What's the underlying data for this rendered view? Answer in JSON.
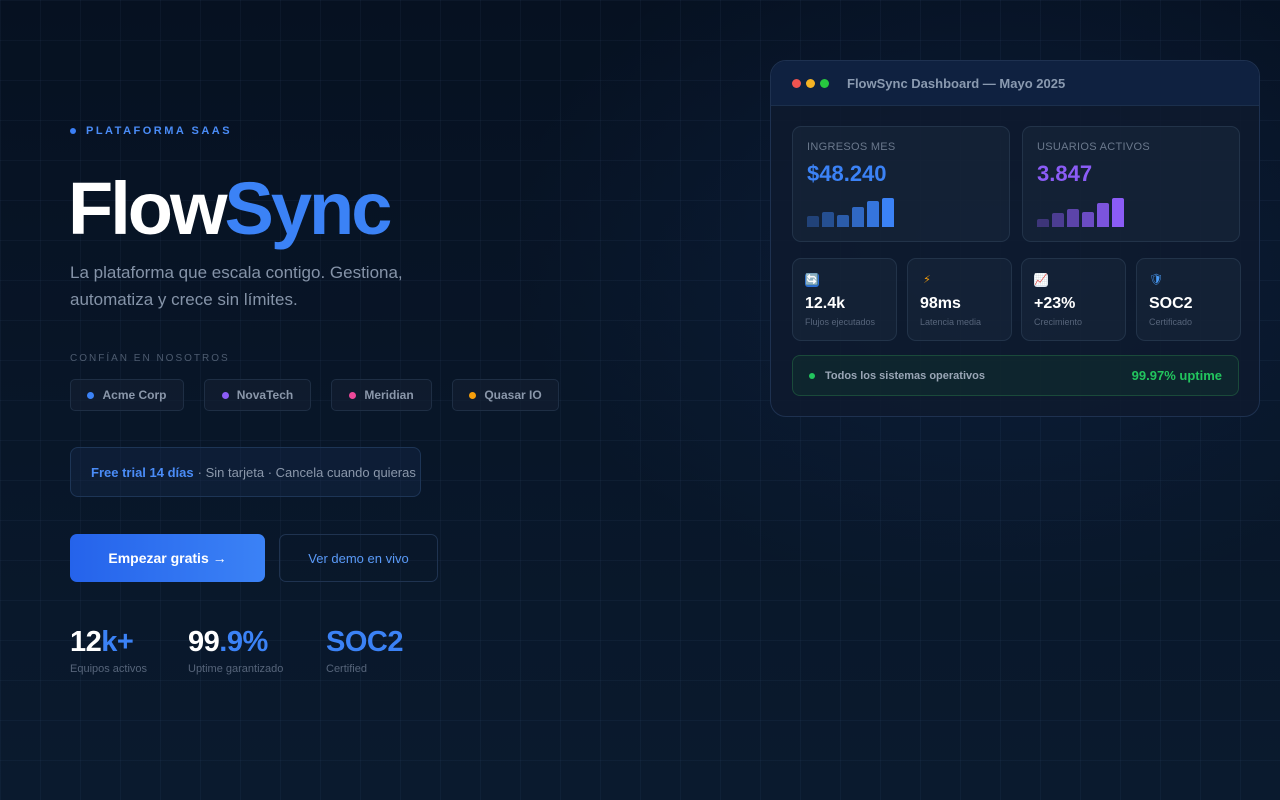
{
  "hero": {
    "eyebrow": "PLATAFORMA SAAS",
    "title_part1": "Flow",
    "title_part2": "Sync",
    "subtitle": "La plataforma que escala contigo. Gestiona, automatiza y crece sin límites.",
    "trust_label": "CONFÍAN EN NOSOTROS",
    "logos": [
      {
        "name": "Acme Corp",
        "color": "#3b82f6"
      },
      {
        "name": "NovaTech",
        "color": "#8b5cf6"
      },
      {
        "name": "Meridian",
        "color": "#ec4899"
      },
      {
        "name": "Quasar IO",
        "color": "#f59e0b"
      }
    ],
    "trial_strong": "Free trial 14 días",
    "trial_rest": "· Sin tarjeta · Cancela cuando quieras",
    "cta_primary": "Empezar gratis →",
    "cta_secondary": "Ver demo en vivo",
    "stats": [
      {
        "value_main": "12",
        "value_accent": "k+",
        "label": "Equipos activos"
      },
      {
        "value_main": "99",
        "value_accent": ".9%",
        "label": "Uptime garantizado"
      },
      {
        "value_main": "",
        "value_accent": "SOC2",
        "label": "Certified"
      }
    ]
  },
  "dashboard": {
    "title": "FlowSync Dashboard — Mayo 2025",
    "window_dots": [
      "#ef5350",
      "#f5b324",
      "#27c93f"
    ],
    "kpis": [
      {
        "label": "INGRESOS MES",
        "value": "$48.240",
        "color": "#3b82f6",
        "bar_levels": [
          0.35,
          0.5,
          0.4,
          0.65,
          0.85,
          0.95
        ]
      },
      {
        "label": "USUARIOS ACTIVOS",
        "value": "3.847",
        "color": "#8b5cf6",
        "bar_levels": [
          0.25,
          0.45,
          0.6,
          0.5,
          0.8,
          0.95
        ]
      }
    ],
    "metrics": [
      {
        "icon": "refresh-icon",
        "glyph": "🔄",
        "value": "12.4k",
        "label": "Flujos ejecutados"
      },
      {
        "icon": "lightning-icon",
        "glyph": "⚡",
        "value": "98ms",
        "label": "Latencia media"
      },
      {
        "icon": "chart-up-icon",
        "glyph": "📈",
        "value": "+23%",
        "label": "Crecimiento"
      },
      {
        "icon": "shield-icon",
        "glyph": "🛡",
        "value": "SOC2",
        "label": "Certificado"
      }
    ],
    "status_text": "Todos los sistemas operativos",
    "uptime": "99.97% uptime"
  }
}
